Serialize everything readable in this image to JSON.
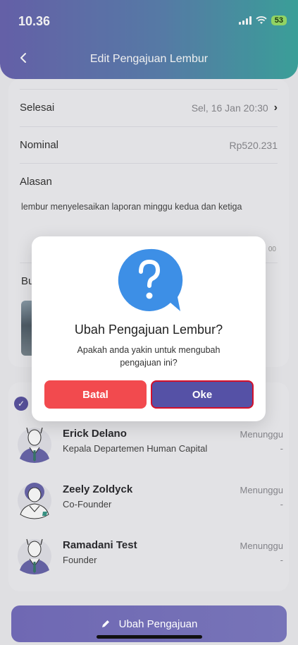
{
  "status_bar": {
    "time": "10.36",
    "battery": "53"
  },
  "header": {
    "title": "Edit  Pengajuan Lembur"
  },
  "detail": {
    "selesai": {
      "label": "Selesai",
      "value": "Sel, 16 Jan 20:30"
    },
    "nominal": {
      "label": "Nominal",
      "value": "Rp520.231"
    },
    "alasan": {
      "label": "Alasan",
      "text": "lembur menyelesaikan laporan minggu kedua dan ketiga"
    },
    "counter": "00",
    "bukti_label": "Bu"
  },
  "approvers": [
    {
      "name": "Erick Delano",
      "role": "Kepala Departemen Human Capital",
      "status": "Menunggu",
      "date": "-"
    },
    {
      "name": "Zeely Zoldyck",
      "role": "Co-Founder",
      "status": "Menunggu",
      "date": "-"
    },
    {
      "name": "Ramadani Test",
      "role": "Founder",
      "status": "Menunggu",
      "date": "-"
    }
  ],
  "dialog": {
    "icon": "question-bubble-icon",
    "title": "Ubah Pengajuan Lembur?",
    "message": "Apakah anda yakin untuk mengubah pengajuan ini?",
    "cancel_label": "Batal",
    "ok_label": "Oke"
  },
  "footer": {
    "submit_label": "Ubah Pengajuan",
    "submit_icon": "pencil-icon"
  },
  "colors": {
    "header_start": "#6b66b2",
    "header_end": "#3ea9a2",
    "primary": "#5551a6",
    "danger": "#f24a4e",
    "dialog_icon": "#3d8fe6"
  }
}
